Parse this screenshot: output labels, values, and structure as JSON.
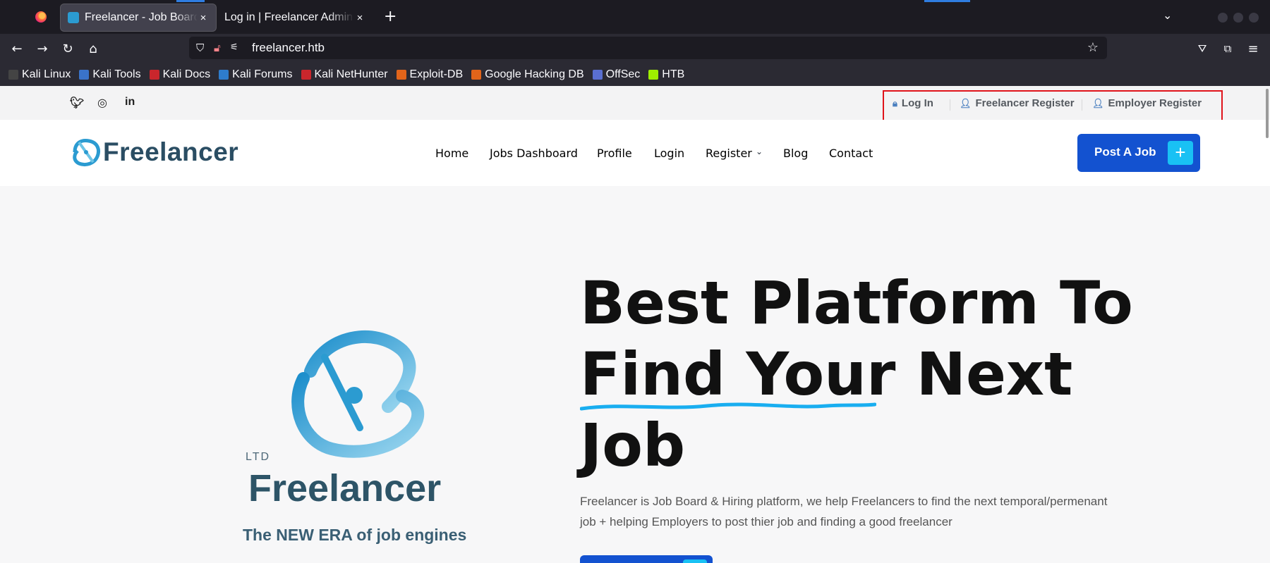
{
  "browser": {
    "tabs": [
      {
        "title": "Freelancer - Job Board",
        "active": true
      },
      {
        "title": "Log in | Freelancer Admin",
        "active": false
      }
    ],
    "new_tab": "+",
    "close": "×",
    "url": "freelancer.htb",
    "bookmarks": [
      "Kali Linux",
      "Kali Tools",
      "Kali Docs",
      "Kali Forums",
      "Kali NetHunter",
      "Exploit-DB",
      "Google Hacking DB",
      "OffSec",
      "HTB"
    ]
  },
  "site": {
    "topbar": {
      "social": [
        "twitter-icon",
        "instagram-icon",
        "linkedin-icon"
      ],
      "links": [
        "Log In",
        "Freelancer Register",
        "Employer Register"
      ]
    },
    "brand": "Freelancer",
    "menu": [
      "Home",
      "Jobs Dashboard",
      "Profile",
      "Login",
      "Register",
      "Blog",
      "Contact"
    ],
    "post_job": "Post A Job",
    "hero": {
      "logo_ltd": "LTD",
      "logo_name": "Freelancer",
      "logo_tagline": "The NEW ERA of job engines",
      "headline_1": "Best Platform To",
      "headline_2a": "Find Your",
      "headline_2b": "Next",
      "headline_3": "Job",
      "description": "Freelancer is Job Board & Hiring platform, we help Freelancers to find the next temporal/permenant job + helping Employers to post thier job and finding a good freelancer"
    },
    "colors": {
      "primary": "#1352d0",
      "accent": "#19c1f4",
      "highlight_box": "#e0141b"
    }
  }
}
